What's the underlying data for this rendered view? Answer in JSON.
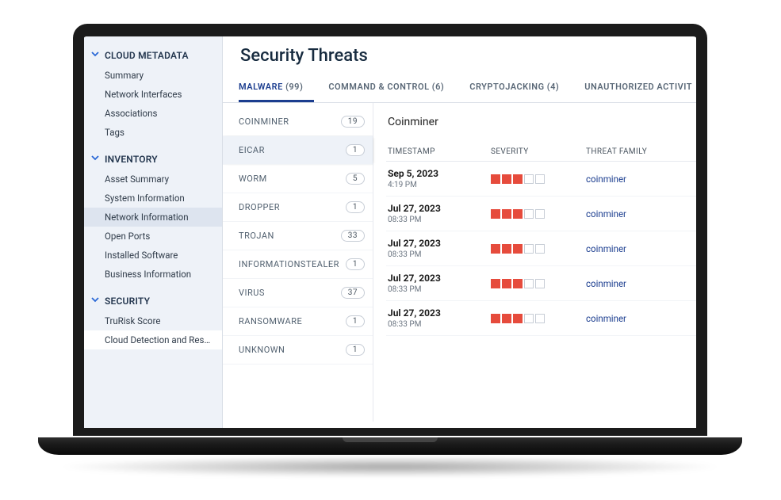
{
  "sidebar": {
    "sections": [
      {
        "title": "CLOUD METADATA",
        "items": [
          {
            "label": "Summary"
          },
          {
            "label": "Network Interfaces"
          },
          {
            "label": "Associations"
          },
          {
            "label": "Tags"
          }
        ]
      },
      {
        "title": "INVENTORY",
        "items": [
          {
            "label": "Asset Summary"
          },
          {
            "label": "System Information"
          },
          {
            "label": "Network Information",
            "active": true
          },
          {
            "label": "Open Ports"
          },
          {
            "label": "Installed Software"
          },
          {
            "label": "Business Information"
          }
        ]
      },
      {
        "title": "SECURITY",
        "items": [
          {
            "label": "TruRisk Score"
          },
          {
            "label": "Cloud Detection and Respon…",
            "activeWhite": true
          }
        ]
      }
    ]
  },
  "main": {
    "title": "Security Threats",
    "tabs": [
      {
        "label": "MALWARE",
        "count": "(99)",
        "selected": true
      },
      {
        "label": "COMMAND & CONTROL",
        "count": "(6)"
      },
      {
        "label": "CRYPTOJACKING",
        "count": "(4)"
      },
      {
        "label": "UNAUTHORIZED ACTIVIT",
        "count": ""
      }
    ],
    "categories": [
      {
        "label": "COINMINER",
        "count": "19"
      },
      {
        "label": "EICAR",
        "count": "1",
        "selected": true
      },
      {
        "label": "WORM",
        "count": "5"
      },
      {
        "label": "DROPPER",
        "count": "1"
      },
      {
        "label": "TROJAN",
        "count": "33"
      },
      {
        "label": "INFORMATIONSTEALER",
        "count": "1"
      },
      {
        "label": "VIRUS",
        "count": "37"
      },
      {
        "label": "RANSOMWARE",
        "count": "1"
      },
      {
        "label": "UNKNOWN",
        "count": "1"
      }
    ],
    "detail": {
      "title": "Coinminer",
      "headers": {
        "timestamp": "TIMESTAMP",
        "severity": "SEVERITY",
        "family": "THREAT FAMILY"
      },
      "rows": [
        {
          "date": "Sep 5, 2023",
          "time": "4:19 PM",
          "sev": 3,
          "family": "coinminer"
        },
        {
          "date": "Jul 27, 2023",
          "time": "08:33 PM",
          "sev": 3,
          "family": "coinminer"
        },
        {
          "date": "Jul 27, 2023",
          "time": "08:33 PM",
          "sev": 3,
          "family": "coinminer"
        },
        {
          "date": "Jul 27, 2023",
          "time": "08:33 PM",
          "sev": 3,
          "family": "coinminer"
        },
        {
          "date": "Jul 27, 2023",
          "time": "08:33 PM",
          "sev": 3,
          "family": "coinminer"
        }
      ]
    }
  }
}
